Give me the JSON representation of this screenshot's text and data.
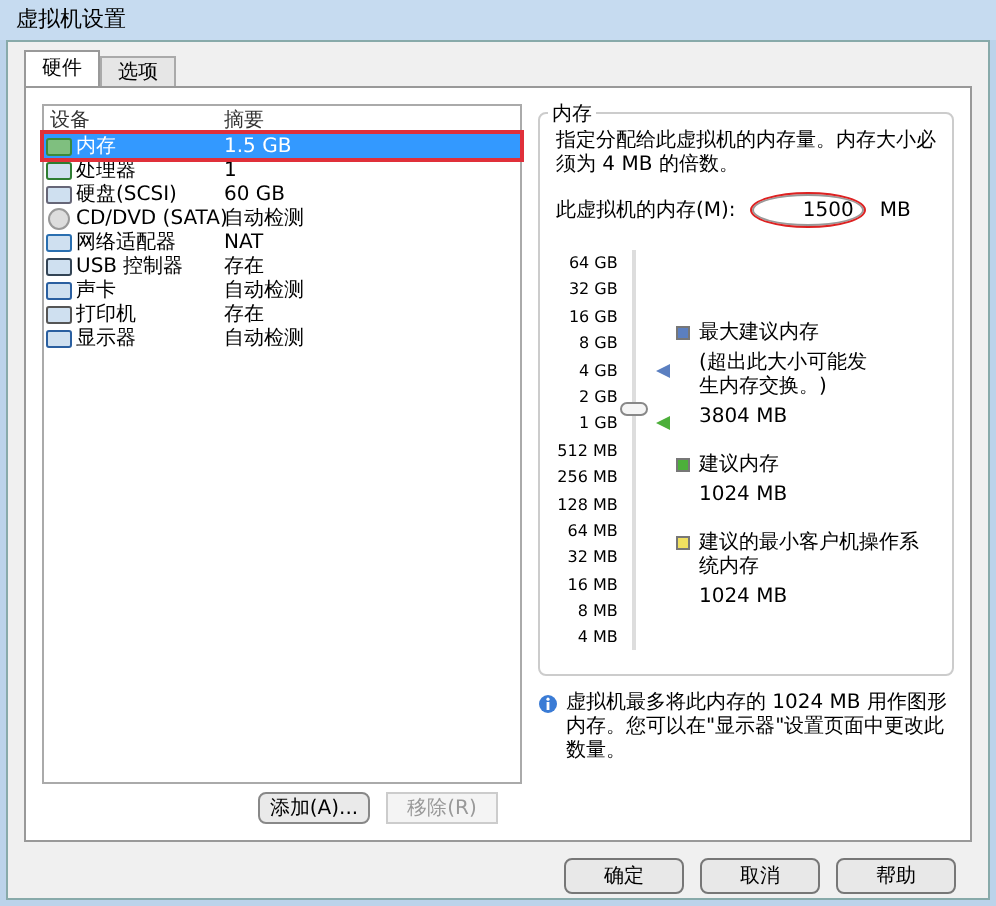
{
  "window": {
    "title": "虚拟机设置"
  },
  "tabs": [
    {
      "label": "硬件",
      "selected": true
    },
    {
      "label": "选项",
      "selected": false
    }
  ],
  "device_table": {
    "columns": [
      "设备",
      "摘要"
    ],
    "rows": [
      {
        "kind": "memory",
        "device": "内存",
        "summary": "1.5 GB",
        "selected": true
      },
      {
        "kind": "cpu",
        "device": "处理器",
        "summary": "1",
        "selected": false
      },
      {
        "kind": "disk",
        "device": "硬盘(SCSI)",
        "summary": "60 GB",
        "selected": false
      },
      {
        "kind": "cd",
        "device": "CD/DVD (SATA)",
        "summary": "自动检测",
        "selected": false
      },
      {
        "kind": "network",
        "device": "网络适配器",
        "summary": "NAT",
        "selected": false
      },
      {
        "kind": "usb",
        "device": "USB 控制器",
        "summary": "存在",
        "selected": false
      },
      {
        "kind": "sound",
        "device": "声卡",
        "summary": "自动检测",
        "selected": false
      },
      {
        "kind": "printer",
        "device": "打印机",
        "summary": "存在",
        "selected": false
      },
      {
        "kind": "display",
        "device": "显示器",
        "summary": "自动检测",
        "selected": false
      }
    ]
  },
  "list_buttons": [
    {
      "label": "添加(A)...",
      "disabled": false
    },
    {
      "label": "移除(R)",
      "disabled": true
    }
  ],
  "memory": {
    "group_title": "内存",
    "description": "指定分配给此虚拟机的内存量。内存大小必须为 4 MB 的倍数。",
    "field_label": "此虚拟机的内存(M):",
    "value": "1500",
    "unit": "MB",
    "scale": [
      "64 GB",
      "32 GB",
      "16 GB",
      "8 GB",
      "4 GB",
      "2 GB",
      "1 GB",
      "512 MB",
      "256 MB",
      "128 MB",
      "64 MB",
      "32 MB",
      "16 MB",
      "8 MB",
      "4 MB"
    ],
    "slider": {
      "level": 0.61
    },
    "markers": [
      {
        "color": "#5b7fc0",
        "level": 0.71,
        "title": "最大建议内存",
        "note": "(超出此大小可能发生内存交换。)",
        "value": "3804 MB"
      },
      {
        "color": "#4caf3a",
        "level": 0.57,
        "title": "建议内存",
        "value": "1024 MB"
      },
      {
        "color": "#f0e060",
        "title": "建议的最小客户机操作系统内存",
        "value": "1024 MB"
      }
    ],
    "info": "虚拟机最多将此内存的 1024 MB 用作图形内存。您可以在\"显示器\"设置页面中更改此数量。"
  },
  "dialog_buttons": [
    "确定",
    "取消",
    "帮助"
  ]
}
